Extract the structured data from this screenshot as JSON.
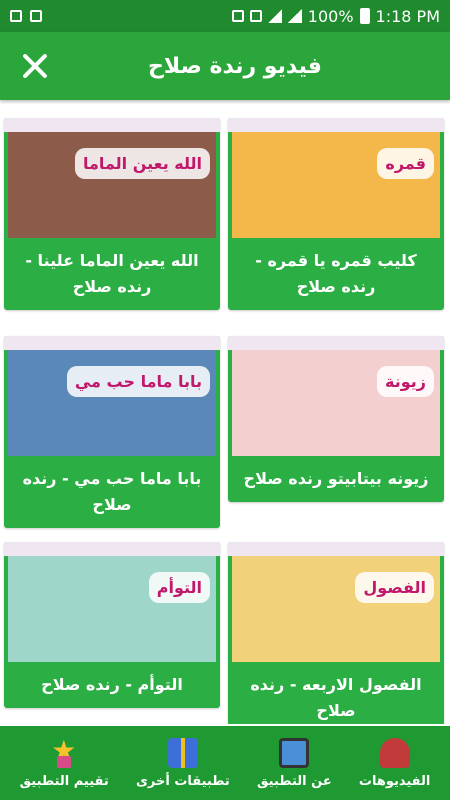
{
  "status_bar": {
    "battery_percent": "100%",
    "time": "1:18 PM"
  },
  "app_bar": {
    "title": "فيديو رندة صلاح"
  },
  "videos": [
    {
      "title": "كليب قمره يا قمره - رنده صلاح",
      "image_caption": "قمره",
      "image_color": "#f4b84a"
    },
    {
      "title": "الله يعين الماما علينا - رنده صلاح",
      "image_caption": "الله يعين الماما",
      "image_color": "#8c5b4a"
    },
    {
      "title": "زيونه بيتابيتو رنده صلاح",
      "image_caption": "زيونة",
      "image_color": "#f3cfd0"
    },
    {
      "title": "بابا ماما حب مي - رنده صلاح",
      "image_caption": "بابا ماما حب مي",
      "image_color": "#5a88b8"
    },
    {
      "title": "الفصول الاربعه - رنده صلاح",
      "image_caption": "الفصول",
      "image_color": "#f1d27a"
    },
    {
      "title": "التوأم - رنده صلاح",
      "image_caption": "التوأم",
      "image_color": "#9ed7c9"
    }
  ],
  "bottom_nav": [
    {
      "label": "الفيديوهات",
      "icon": "house-icon"
    },
    {
      "label": "عن التطبيق",
      "icon": "film-icon"
    },
    {
      "label": "تطبيقات أخرى",
      "icon": "gift-icon"
    },
    {
      "label": "تقييم التطبيق",
      "icon": "star-icon"
    }
  ]
}
